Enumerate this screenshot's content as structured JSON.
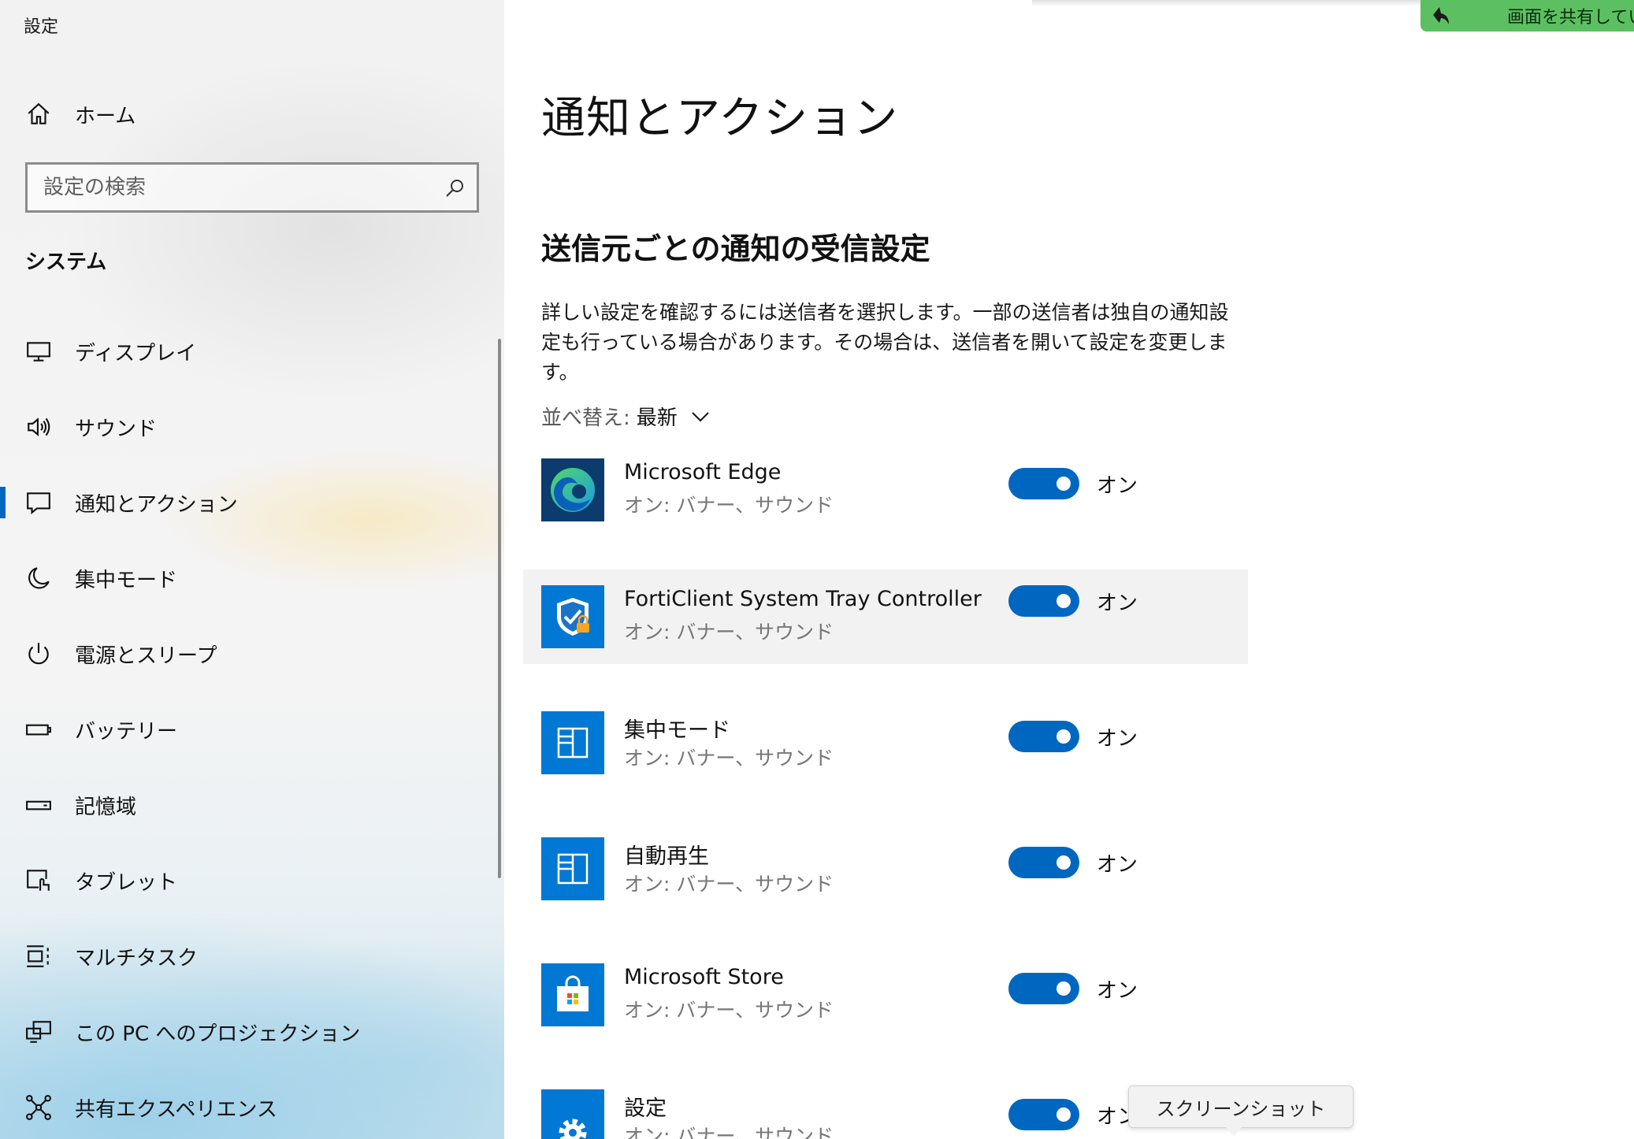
{
  "window": {
    "title": "設定"
  },
  "sidebar": {
    "home_label": "ホーム",
    "search_placeholder": "設定の検索",
    "section_label": "システム",
    "items": [
      {
        "label": "ディスプレイ",
        "icon": "display-icon"
      },
      {
        "label": "サウンド",
        "icon": "speaker-icon"
      },
      {
        "label": "通知とアクション",
        "icon": "notification-icon",
        "selected": true
      },
      {
        "label": "集中モード",
        "icon": "moon-icon"
      },
      {
        "label": "電源とスリープ",
        "icon": "power-icon"
      },
      {
        "label": "バッテリー",
        "icon": "battery-icon"
      },
      {
        "label": "記憶域",
        "icon": "storage-icon"
      },
      {
        "label": "タブレット",
        "icon": "tablet-icon"
      },
      {
        "label": "マルチタスク",
        "icon": "multitask-icon"
      },
      {
        "label": "この PC へのプロジェクション",
        "icon": "projection-icon"
      },
      {
        "label": "共有エクスペリエンス",
        "icon": "share-experience-icon"
      }
    ]
  },
  "main": {
    "page_title": "通知とアクション",
    "section_title": "送信元ごとの通知の受信設定",
    "description_line1": "詳しい設定を確認するには送信者を選択します。一部の送信者は独自の通知設",
    "description_line2": "定も行っている場合があります。その場合は、送信者を開いて設定を変更します。",
    "sort_label": "並べ替え:",
    "sort_value": "最新",
    "senders": [
      {
        "name": "Microsoft Edge",
        "sub": "オン: バナー、サウンド",
        "toggle_label": "オン",
        "on": true,
        "icon": "edge-icon"
      },
      {
        "name": "FortiClient System Tray Controller",
        "sub": "オン: バナー、サウンド",
        "toggle_label": "オン",
        "on": true,
        "icon": "forticlient-icon"
      },
      {
        "name": "集中モード",
        "sub": "オン: バナー、サウンド",
        "toggle_label": "オン",
        "on": true,
        "icon": "app-tile-icon"
      },
      {
        "name": "自動再生",
        "sub": "オン: バナー、サウンド",
        "toggle_label": "オン",
        "on": true,
        "icon": "app-tile-icon"
      },
      {
        "name": "Microsoft Store",
        "sub": "オン: バナー、サウンド",
        "toggle_label": "オン",
        "on": true,
        "icon": "store-icon"
      },
      {
        "name": "設定",
        "sub": "オン: バナー、サウンド",
        "toggle_label": "オン",
        "on": true,
        "icon": "gear-icon"
      }
    ]
  },
  "overlay": {
    "share_banner_text": "画面を共有してい",
    "tooltip_text": "スクリーンショット"
  },
  "colors": {
    "accent": "#0067c0",
    "tile_blue": "#0078d4",
    "share_green": "#5cc062"
  }
}
